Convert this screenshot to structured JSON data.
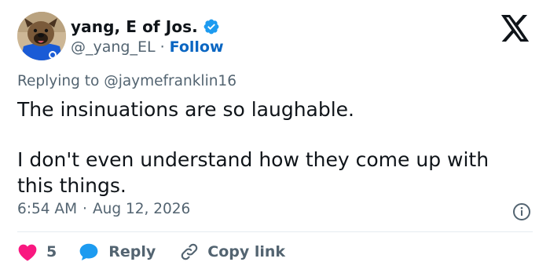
{
  "author": {
    "display_name": "yang, E of Jos.",
    "handle": "@_yang_EL",
    "separator": "·",
    "follow_label": "Follow",
    "avatar": "dog-in-blue-jersey-avatar",
    "verified_icon": "verified-badge-icon"
  },
  "platform_logo": "x-logo-icon",
  "reply_context": {
    "prefix": "Replying to",
    "mention": "@jaymefranklin16"
  },
  "tweet": {
    "paragraphs": [
      "The insinuations are so laughable.",
      "I don't even understand how they come up with this things."
    ]
  },
  "meta": {
    "time": "6:54 AM",
    "separator": "·",
    "date": "Aug 12, 2026",
    "info_icon": "info-icon"
  },
  "actions": {
    "like_count": "5",
    "reply_label": "Reply",
    "copy_link_label": "Copy link"
  },
  "colors": {
    "link_blue": "#0a66c2",
    "verified_blue": "#1d9bf0",
    "heart_red": "#f91880",
    "text_primary": "#0f1419",
    "text_secondary": "#536471",
    "divider": "#e6ecf0"
  }
}
